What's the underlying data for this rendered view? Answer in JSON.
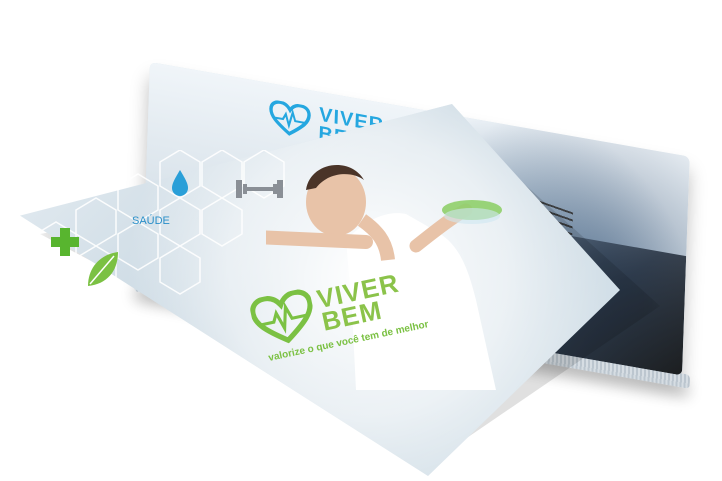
{
  "back_brochure": {
    "logo_line1": "VIVER",
    "logo_line2": "BEM",
    "brand_color": "#25a7e0"
  },
  "front_brochure": {
    "hex_label": "SAÚDE",
    "logo_line1": "VIVER",
    "logo_line2": "BEM",
    "tagline": "valorize o que você tem de melhor",
    "brand_color": "#7bc143",
    "icons": [
      "plus-icon",
      "water-drop-icon",
      "dumbbell-icon",
      "leaf-icon"
    ]
  }
}
